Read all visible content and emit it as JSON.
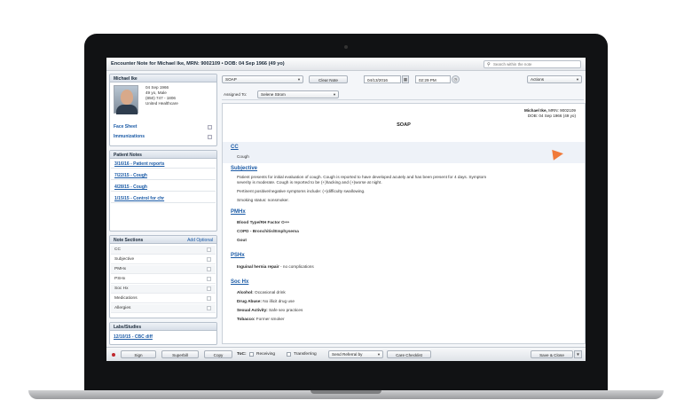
{
  "window": {
    "title": "Encounter Note for Michael Ike, MRN: 9002109 • DOB: 04 Sep 1966 (49 yo)",
    "search_placeholder": "Search within the note"
  },
  "patient": {
    "panel_title": "Michael Ike",
    "dob": "04 Sep 1966",
    "age_sex": "49 yo, Male",
    "phone": "(850) 747 - 1806",
    "insurer": "United Healthcare",
    "face_sheet": "Face Sheet",
    "immunizations": "Immunizations"
  },
  "patient_notes": {
    "title": "Patient Notes",
    "items": [
      "3/16/16 - Patient reports",
      "7/22/15 - Cough",
      "4/28/15 - Cough",
      "1/15/15 - Control for chr"
    ]
  },
  "note_sections": {
    "title": "Note Sections",
    "add_label": "Add Optional",
    "items": [
      "CC",
      "Subjective",
      "PMHx",
      "PSHx",
      "Soc Hx",
      "Medications",
      "Allergies"
    ]
  },
  "labs": {
    "title": "Labs/Studies",
    "items": [
      "12/10/15 - CBC diff"
    ]
  },
  "toolbar": {
    "template_value": "SOAP",
    "clear_note": "Clear Note",
    "date_value": "04/13/2016",
    "time_value": "02:29 PM",
    "actions": "Actions",
    "assigned_label": "Assigned To:",
    "assigned_value": "Selene Strom"
  },
  "document": {
    "header_name": "Michael Ike,",
    "header_mrn": "MRN: 9002109",
    "header_dob": "DOB: 04 Sep 1966 (49 yo)",
    "title": "SOAP",
    "cc_heading": "CC",
    "cc_text": "Cough",
    "subjective_heading": "Subjective",
    "subjective_line1": "Patient presents for initial evaluation of cough. Cough is reported to have developed acutely and has been present for 4 days. Symptom",
    "subjective_line2": "severity is moderate. Cough is reported to be (+)hacking and (+)worse at night.",
    "subjective_line3": "Pertinent positive/negative symptoms include: (+)difficulty swallowing.",
    "subjective_line4": "Smoking status: nonsmoker.",
    "pmhx_heading": "PMHx",
    "pmhx_items": [
      "Blood Type/RH Factor O++",
      "COPD - Bronchitis/Emphysema",
      "Gout"
    ],
    "pshx_heading": "PSHx",
    "pshx_bold": "Inguinal hernia repair",
    "pshx_rest": " - no complications",
    "sochx_heading": "Soc Hx",
    "sochx": [
      {
        "label": "Alcohol:",
        "value": " Occasional drink"
      },
      {
        "label": "Drug Abuse:",
        "value": " No illicit drug use"
      },
      {
        "label": "Sexual Activity:",
        "value": " Safe sex practices"
      },
      {
        "label": "Tobacco:",
        "value": " Former smoker"
      }
    ]
  },
  "bottombar": {
    "sign": "Sign",
    "superbill": "Superbill",
    "copy": "Copy",
    "toc_label": "ToC:",
    "receiving": "Receiving",
    "transferring": "Transferring",
    "send_referral": "Send Referral by",
    "care_checklist": "Care Checklist",
    "save_close": "Save & Close"
  },
  "colors": {
    "link": "#1a5aa6",
    "accent_arrow": "#f07a3a",
    "sign_dot": "#c0282d"
  }
}
